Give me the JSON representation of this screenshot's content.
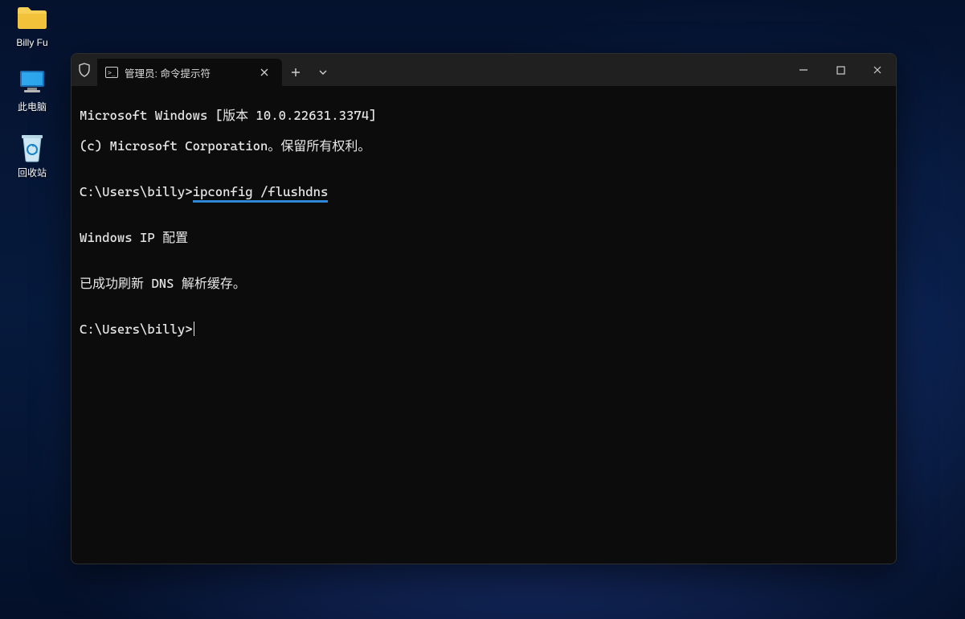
{
  "desktop": {
    "icons": [
      {
        "name": "folder-icon",
        "label": "Billy Fu"
      },
      {
        "name": "this-pc-icon",
        "label": "此电脑"
      },
      {
        "name": "recycle-bin-icon",
        "label": "回收站"
      }
    ]
  },
  "window": {
    "tab": {
      "shield_name": "admin-shield-icon",
      "cmd_icon_name": "cmd-icon",
      "title": "管理员: 命令提示符"
    },
    "controls": {
      "new_tab": "new-tab-button",
      "dropdown": "tab-dropdown-button",
      "minimize": "minimize-button",
      "maximize": "maximize-button",
      "close": "close-window-button"
    }
  },
  "terminal": {
    "line1": "Microsoft Windows [版本 10.0.22631.3374]",
    "line2": "(c) Microsoft Corporation。保留所有权利。",
    "blank": "",
    "prompt1_prefix": "C:\\Users\\billy>",
    "prompt1_cmd": "ipconfig /flushdns",
    "line3": "Windows IP 配置",
    "line4": "已成功刷新 DNS 解析缓存。",
    "prompt2_prefix": "C:\\Users\\billy>"
  }
}
